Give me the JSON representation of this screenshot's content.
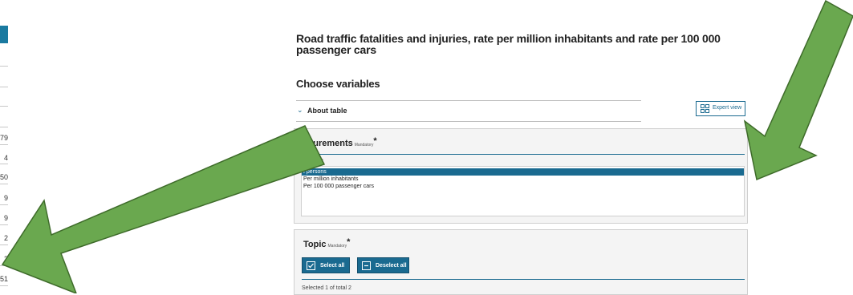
{
  "left_table": {
    "values": [
      "79",
      "4",
      "50",
      "9",
      "9",
      "2",
      "2",
      "51"
    ]
  },
  "page": {
    "title": "Road traffic fatalities and injuries, rate per million inhabitants and rate per 100 000 passenger cars",
    "choose_variables": "Choose variables",
    "about_table": "About table",
    "expert_view": "Expert view"
  },
  "measurements": {
    "title": "asurements",
    "mandatory": "Mandatory",
    "star": "*",
    "count": "of total 3",
    "options": [
      "f persons",
      "Per million inhabitants",
      "Per 100 000 passenger cars"
    ]
  },
  "topic": {
    "title": "Topic",
    "mandatory": "Mandatory",
    "star": "*",
    "select_all": "Select all",
    "deselect_all": "Deselect all",
    "count": "Selected 1 of total 2"
  },
  "colors": {
    "accent": "#1a6a90",
    "arrow_fill": "#6aa84f",
    "arrow_stroke": "#3e6b2a",
    "panel_bg": "#f4f4f4"
  }
}
